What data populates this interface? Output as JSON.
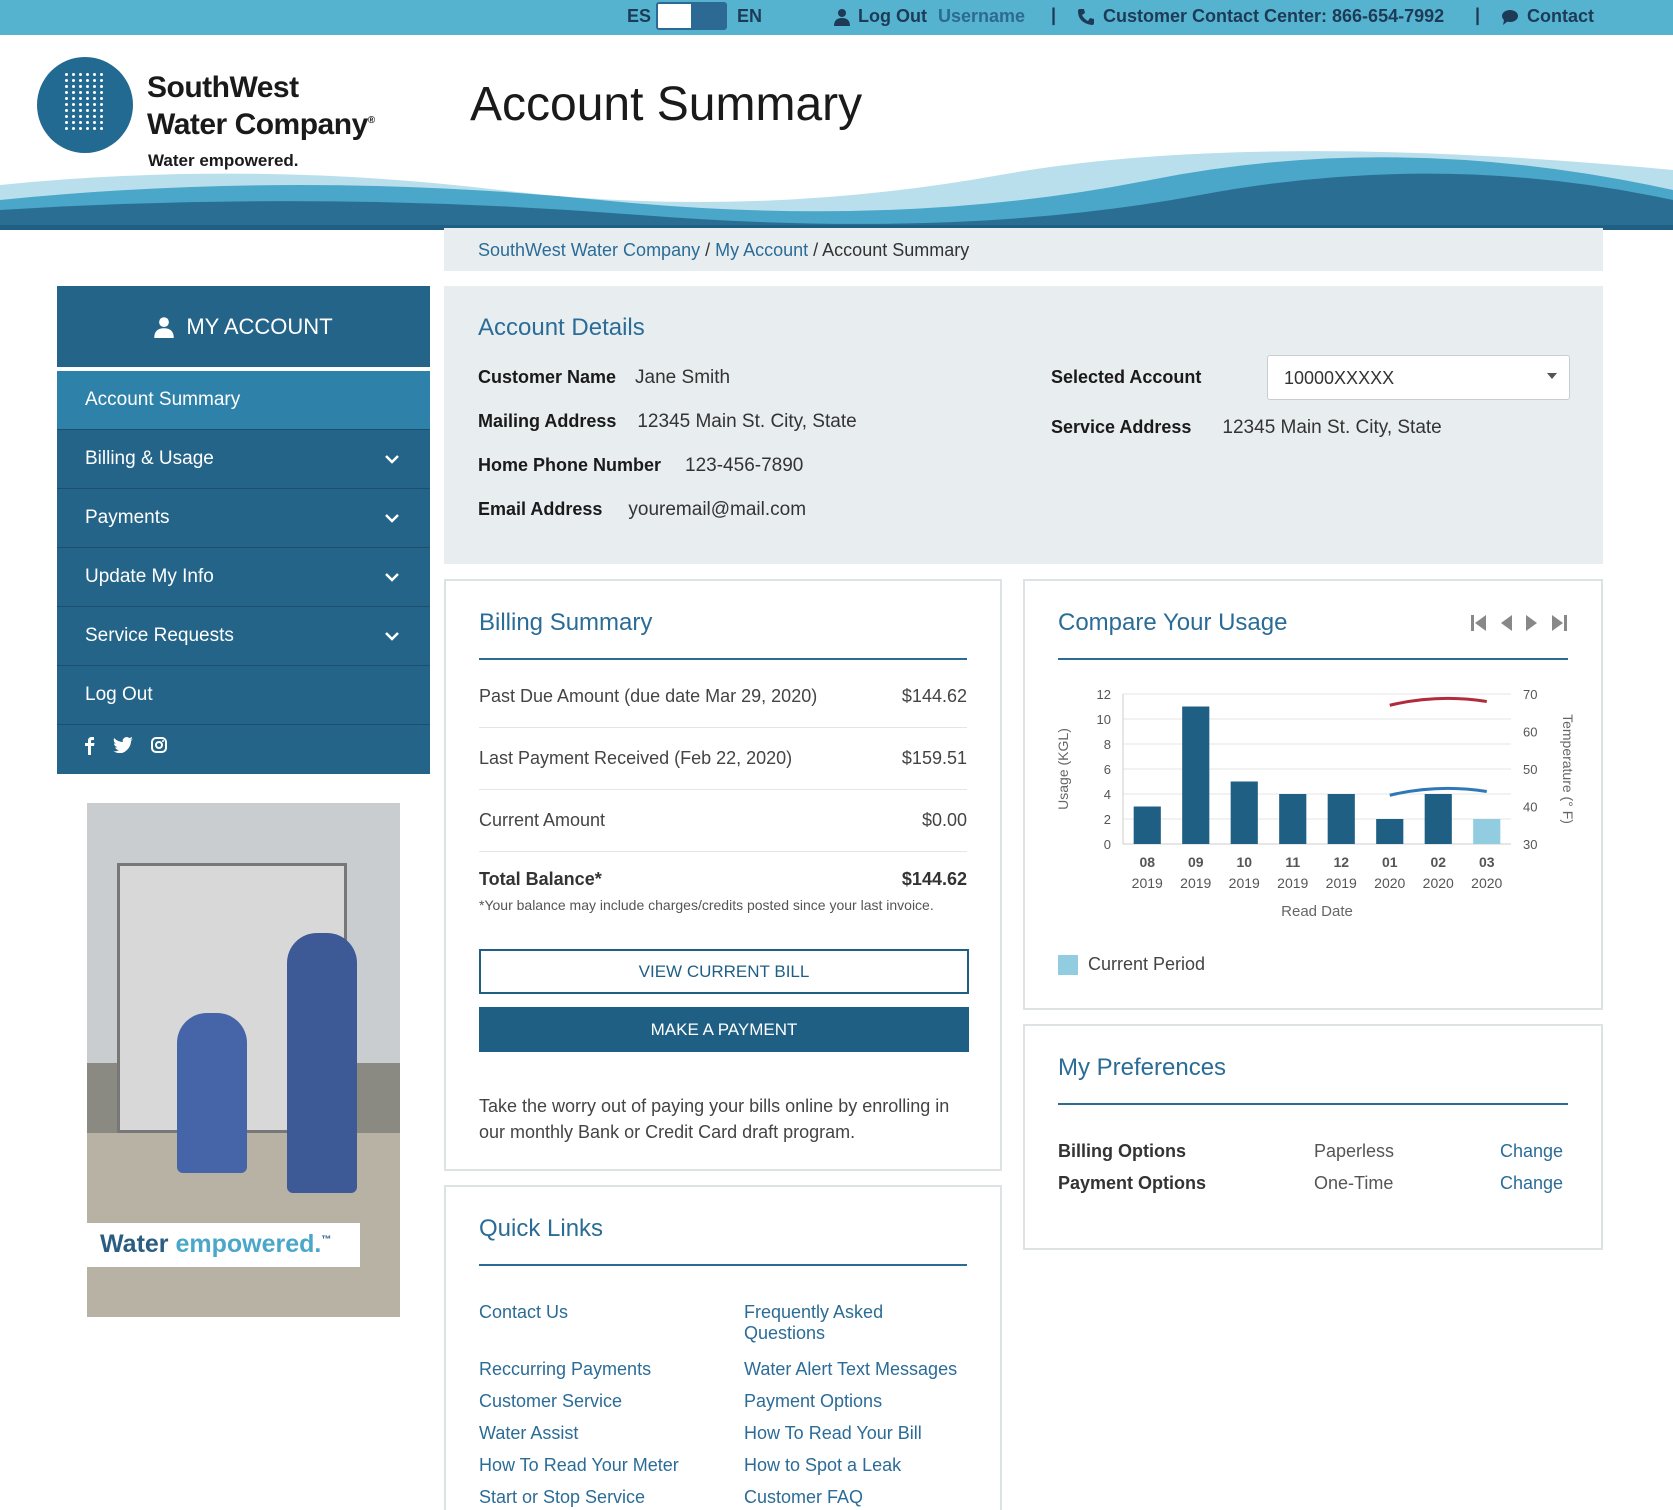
{
  "topbar": {
    "lang_es": "ES",
    "lang_en": "EN",
    "logout": "Log Out",
    "username": "Username",
    "separator": "|",
    "phone": "Customer Contact Center: 866-654-7992",
    "contact": "Contact"
  },
  "header": {
    "logo_line1": "SouthWest",
    "logo_line2": "Water Company",
    "logo_tagline": "Water empowered.",
    "page_title": "Account Summary"
  },
  "breadcrumb": {
    "items": [
      "SouthWest Water Company",
      "My Account"
    ],
    "separator": " / ",
    "current": "Account Summary"
  },
  "sidebar": {
    "title": "MY ACCOUNT",
    "items": [
      {
        "label": "Account Summary",
        "active": true,
        "expandable": false
      },
      {
        "label": "Billing & Usage",
        "active": false,
        "expandable": true
      },
      {
        "label": "Payments",
        "active": false,
        "expandable": true
      },
      {
        "label": "Update My Info",
        "active": false,
        "expandable": true
      },
      {
        "label": "Service Requests",
        "active": false,
        "expandable": true
      },
      {
        "label": "Log Out",
        "active": false,
        "expandable": false
      }
    ],
    "social_icons": [
      "facebook-icon",
      "twitter-icon",
      "instagram-icon"
    ]
  },
  "promo": {
    "banner_part1": "Water ",
    "banner_part2": "empowered.",
    "banner_mark": "™"
  },
  "account_details": {
    "title": "Account Details",
    "customer_name_label": "Customer Name",
    "customer_name": "Jane Smith",
    "mailing_address_label": "Mailing Address",
    "mailing_address": "12345 Main St. City, State",
    "home_phone_label": "Home Phone Number",
    "home_phone": "123-456-7890",
    "email_label": "Email Address",
    "email": "youremail@mail.com",
    "selected_account_label": "Selected Account",
    "selected_account": "10000XXXXX",
    "service_address_label": "Service Address",
    "service_address": "12345 Main St. City, State"
  },
  "billing_summary": {
    "title": "Billing Summary",
    "rows": [
      {
        "label": "Past Due Amount (due date Mar 29, 2020)",
        "value": "$144.62"
      },
      {
        "label": "Last Payment Received (Feb 22, 2020)",
        "value": "$159.51"
      },
      {
        "label": "Current Amount",
        "value": "$0.00"
      }
    ],
    "total_label": "Total Balance*",
    "total_value": "$144.62",
    "footnote": "*Your balance may include charges/credits posted since your last invoice.",
    "view_bill_button": "VIEW CURRENT BILL",
    "make_payment_button": "MAKE A PAYMENT",
    "promo_text": "Take the worry out of paying your bills online by enrolling in our monthly Bank or Credit Card draft program."
  },
  "compare_usage": {
    "title": "Compare Your Usage",
    "legend_label": "Current Period"
  },
  "chart_data": {
    "type": "bar",
    "categories": [
      "08 2019",
      "09 2019",
      "10 2019",
      "11 2019",
      "12 2019",
      "01 2020",
      "02 2020",
      "03 2020"
    ],
    "tick_top": [
      "08",
      "09",
      "10",
      "11",
      "12",
      "01",
      "02",
      "03"
    ],
    "tick_bottom": [
      "2019",
      "2019",
      "2019",
      "2019",
      "2019",
      "2020",
      "2020",
      "2020"
    ],
    "series": [
      {
        "values": [
          3,
          11,
          5,
          4,
          4,
          2,
          4,
          2
        ],
        "color": "#1f5f84",
        "highlight_last_color": "#92cce0"
      }
    ],
    "temperature_lines": [
      {
        "color": "#b02b3c",
        "points": [
          {
            "x": "01 2020",
            "y": 67
          },
          {
            "x": "02 2020",
            "y": 69
          },
          {
            "x": "03 2020",
            "y": 68
          }
        ]
      },
      {
        "color": "#2e78b8",
        "points": [
          {
            "x": "01 2020",
            "y": 43
          },
          {
            "x": "02 2020",
            "y": 45
          },
          {
            "x": "03 2020",
            "y": 44
          }
        ]
      }
    ],
    "y_ticks": [
      0,
      2,
      4,
      6,
      8,
      10,
      12
    ],
    "y2_ticks": [
      30,
      40,
      50,
      60,
      70
    ],
    "ylim": [
      0,
      12
    ],
    "y2lim": [
      30,
      70
    ],
    "ylabel": "Usage (KGL)",
    "y2label": "Temperature (° F)",
    "xlabel": "Read Date",
    "grid": true
  },
  "preferences": {
    "title": "My Preferences",
    "rows": [
      {
        "label": "Billing Options",
        "value": "Paperless",
        "action": "Change"
      },
      {
        "label": "Payment Options",
        "value": "One-Time",
        "action": "Change"
      }
    ]
  },
  "quick_links": {
    "title": "Quick Links",
    "left": [
      "Contact Us",
      "Reccurring Payments",
      "Customer Service",
      "Water Assist",
      "How To Read Your Meter",
      "Start or Stop Service"
    ],
    "right_faq_line1": "Frequently Asked",
    "right_faq_line2": "Questions",
    "right": [
      "Water Alert Text Messages",
      "Payment Options",
      "How To Read Your Bill",
      "How to Spot a Leak",
      "Customer FAQ"
    ]
  }
}
